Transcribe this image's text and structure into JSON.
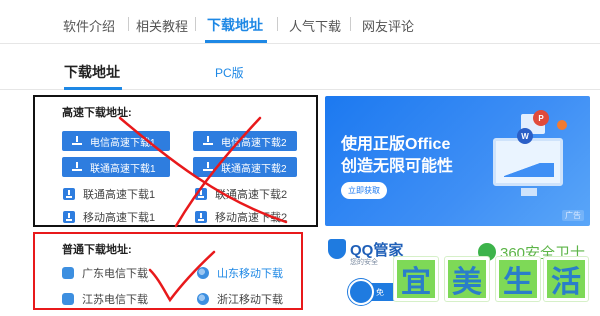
{
  "top_nav": {
    "tabs": [
      {
        "label": "软件介绍"
      },
      {
        "label": "相关教程"
      },
      {
        "label": "下载地址",
        "active": true
      },
      {
        "label": "人气下载"
      },
      {
        "label": "网友评论"
      }
    ],
    "accent_color": "#1e88e5"
  },
  "sub_nav": {
    "tabs": [
      {
        "label": "下载地址",
        "active": true
      },
      {
        "label": "PC版"
      }
    ]
  },
  "fast_download": {
    "title": "高速下载地址:",
    "buttons": [
      {
        "label": "电信高速下载1"
      },
      {
        "label": "电信高速下载2"
      },
      {
        "label": "联通高速下载1"
      },
      {
        "label": "联通高速下载2"
      }
    ],
    "links": [
      {
        "label": "联通高速下载1"
      },
      {
        "label": "联通高速下载2"
      },
      {
        "label": "移动高速下载1"
      },
      {
        "label": "移动高速下载2"
      }
    ],
    "button_color": "#2e7ddf",
    "annotation": "red-cross-mark"
  },
  "normal_download": {
    "title": "普通下载地址:",
    "links": [
      {
        "label": "广东电信下载",
        "icon": "shield-icon"
      },
      {
        "label": "山东移动下载",
        "icon": "globe-icon"
      },
      {
        "label": "江苏电信下载",
        "icon": "shield-icon"
      },
      {
        "label": "浙江移动下载",
        "icon": "globe-icon"
      }
    ],
    "border_color": "#e8191b",
    "annotation": "red-check-mark"
  },
  "ad_office": {
    "line1": "使用正版Office",
    "line2": "创造无限可能性",
    "cta": "立即获取",
    "tag": "广告",
    "bubbles": [
      "W",
      "P"
    ]
  },
  "ad_qq": {
    "name": "QQ管家",
    "slogan": "您的安全",
    "download_label": "免"
  },
  "ad_360": {
    "name": "360安全卫士"
  },
  "watermark": {
    "chars": [
      "宜",
      "美",
      "生",
      "活"
    ]
  }
}
